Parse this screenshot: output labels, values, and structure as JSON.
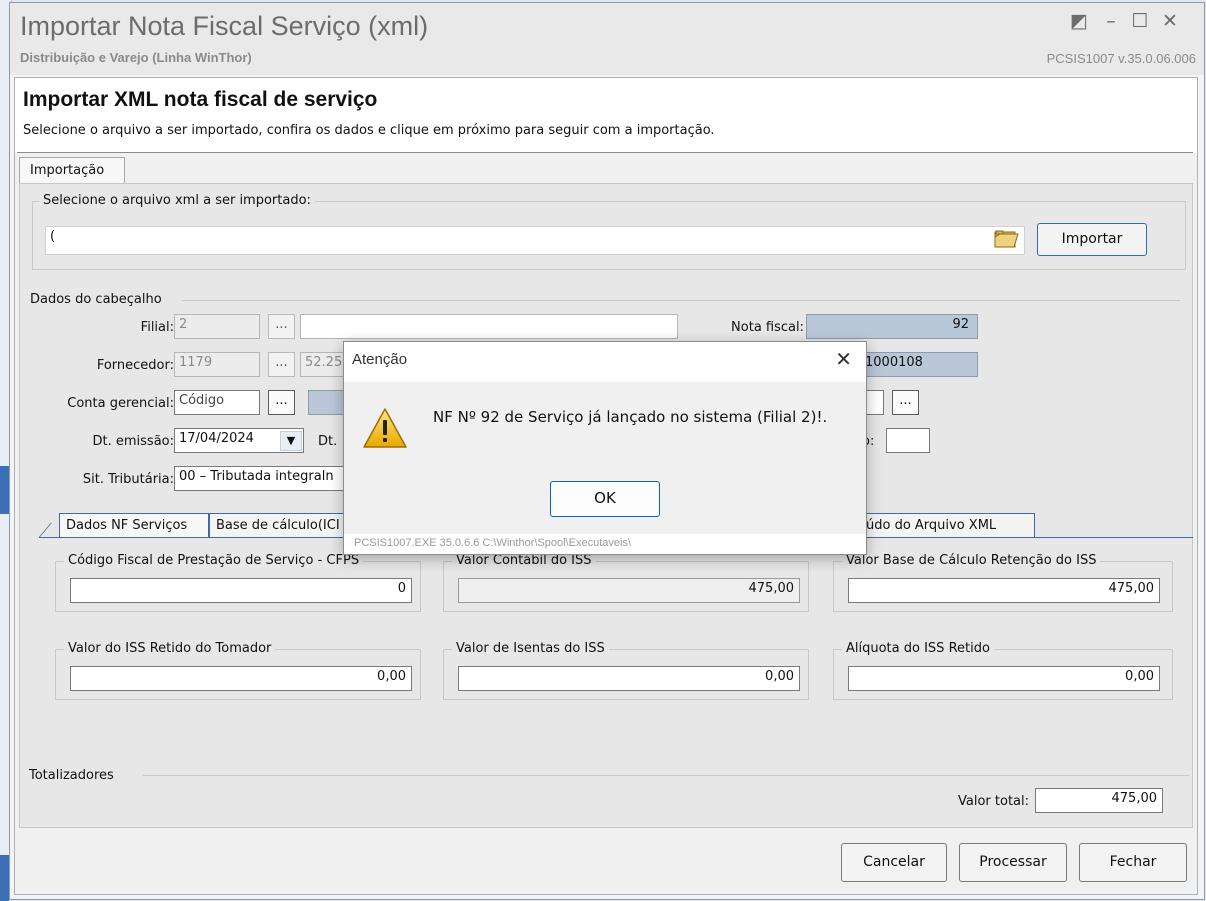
{
  "window": {
    "title": "Importar Nota Fiscal Serviço (xml)",
    "subtitle": "Distribuição e Varejo (Linha WinThor)",
    "version": "PCSIS1007  v.35.0.06.006"
  },
  "header": {
    "title": "Importar XML nota fiscal de serviço",
    "subtitle": "Selecione o arquivo a ser importado, confira os dados e clique em próximo para seguir com a importação."
  },
  "tabs": {
    "importacao": "Importação"
  },
  "file_select": {
    "label": "Selecione o arquivo xml a ser importado:",
    "value": "(",
    "import_button": "Importar"
  },
  "dados": {
    "label": "Dados do cabeçalho",
    "filial_label": "Filial:",
    "filial_value": "2",
    "fornecedor_label": "Fornecedor:",
    "fornecedor_value": "1179",
    "fornecedor_cnpj": "52.25",
    "conta_label": "Conta gerencial:",
    "conta_value": "Código",
    "dt_emissao_label": "Dt. emissão:",
    "dt_emissao_value": "17/04/2024",
    "dt2_label": "Dt.",
    "sit_label": "Sit. Tributária:",
    "sit_value": "00 – Tributada integraln",
    "nota_label": "Nota fiscal:",
    "nota_value": "92",
    "code_value": "1000108",
    "o_label": "o:",
    "dots": "..."
  },
  "subtabs": [
    "Dados NF Serviços",
    "Base de cálculo(ICI",
    "eúdo do Arquivo XML"
  ],
  "fields": {
    "cfps_label": "Código Fiscal de Prestação de Serviço - CFPS",
    "cfps_value": "0",
    "contabil_label": "Valor Contábil do ISS",
    "contabil_value": "475,00",
    "base_label": "Valor Base de Cálculo Retenção do ISS",
    "base_value": "475,00",
    "retido_label": "Valor do ISS Retido do Tomador",
    "retido_value": "0,00",
    "isentas_label": "Valor de Isentas do ISS",
    "isentas_value": "0,00",
    "aliquota_label": "Alíquota do ISS Retido",
    "aliquota_value": "0,00"
  },
  "totalizadores": {
    "label": "Totalizadores",
    "total_label": "Valor total:",
    "total_value": "475,00"
  },
  "buttons": {
    "cancelar": "Cancelar",
    "processar": "Processar",
    "fechar": "Fechar"
  },
  "dialog": {
    "title": "Atenção",
    "message": "NF Nº 92 de Serviço já lançado no sistema (Filial 2)!.",
    "ok": "OK",
    "footer": "PCSIS1007.EXE 35.0.6.6 C:\\Winthor\\Spool\\Executaveis\\"
  },
  "icons": {
    "folder": "folder-open-icon",
    "warning": "warning-icon",
    "close": "close-icon"
  },
  "colors": {
    "accent": "#0b61c4",
    "readonly_blue": "#b9c7d8",
    "tab_border": "#3e6ba8"
  }
}
